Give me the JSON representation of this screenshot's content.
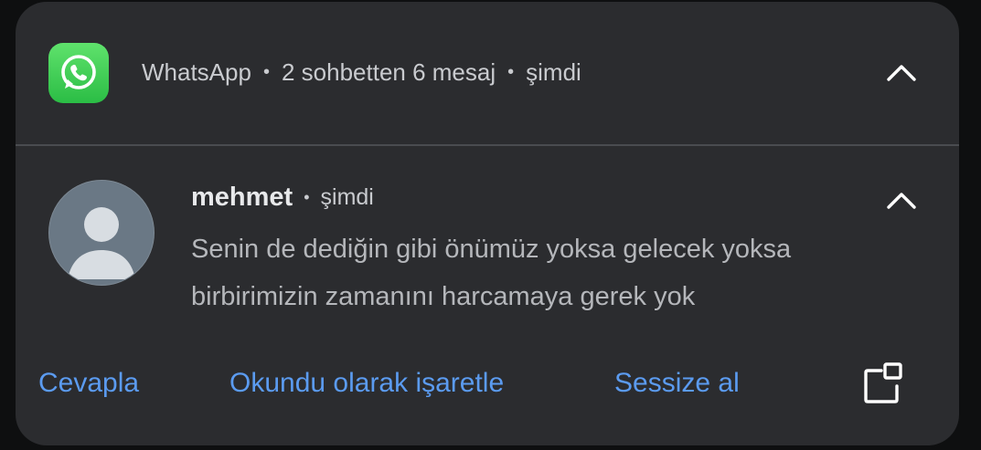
{
  "header": {
    "app_name": "WhatsApp",
    "summary": "2 sohbetten 6 mesaj",
    "time": "şimdi",
    "app_icon": "whatsapp-icon",
    "accent_color": "#2bbd45"
  },
  "message": {
    "sender": "mehmet",
    "time": "şimdi",
    "text": "Senin de dediğin gibi önümüz yoksa gelecek yoksa birbirimizin zamanını harcamaya gerek yok",
    "avatar_icon": "default-avatar-icon"
  },
  "actions": {
    "reply_label": "Cevapla",
    "mark_read_label": "Okundu olarak işaretle",
    "mute_label": "Sessize al",
    "bubble_icon": "bubble-icon",
    "accent_color": "#5b9bf0"
  }
}
